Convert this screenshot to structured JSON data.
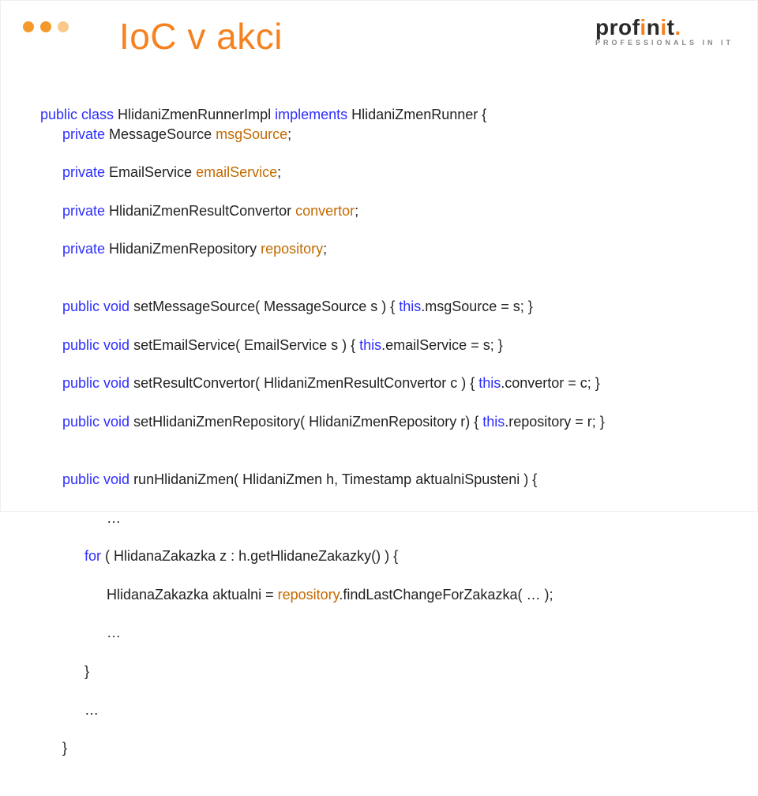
{
  "logo": {
    "brand_black": "prof",
    "brand_orange_i": "i",
    "brand_black2": "n",
    "brand_orange_i2": "i",
    "brand_black3": "t",
    "dot": ".",
    "tagline": "PROFESSIONALS IN IT"
  },
  "title": "IoC v akci",
  "code": {
    "l1_kw": "public class",
    "l1_rest": " HlidaniZmenRunnerImpl ",
    "l1_kw2": "implements",
    "l1_rest2": " HlidaniZmenRunner {",
    "l2_kw": "private",
    "l2_ty": " MessageSource ",
    "l2_fld": "msgSource",
    "l2_end": ";",
    "l3_kw": "private",
    "l3_ty": " EmailService ",
    "l3_fld": "emailService",
    "l3_end": ";",
    "l4_kw": "private",
    "l4_ty": " HlidaniZmenResultConvertor ",
    "l4_fld": "convertor",
    "l4_end": ";",
    "l5_kw": "private",
    "l5_ty": " HlidaniZmenRepository ",
    "l5_fld": "repository",
    "l5_end": ";",
    "l7_kw": "public void",
    "l7_rest": " setMessageSource( MessageSource s ) { ",
    "l7_kw2": "this",
    "l7_rest2": ".msgSource = s; }",
    "l8_kw": "public void",
    "l8_rest": " setEmailService( EmailService s ) { ",
    "l8_kw2": "this",
    "l8_rest2": ".emailService = s; }",
    "l9_kw": "public void",
    "l9_rest": " setResultConvertor( HlidaniZmenResultConvertor c ) { ",
    "l9_kw2": "this",
    "l9_rest2": ".convertor = c; }",
    "l10_kw": "public void",
    "l10_rest": " setHlidaniZmenRepository( HlidaniZmenRepository r) { ",
    "l10_kw2": "this",
    "l10_rest2": ".repository = r; }",
    "l12_kw": "public void",
    "l12_rest": " runHlidaniZmen( HlidaniZmen h, Timestamp aktualniSpusteni ) {",
    "l13": "…",
    "l14_kw": "for",
    "l14_rest": " ( HlidanaZakazka z : h.getHlidaneZakazky() ) {",
    "l15_a": "HlidanaZakazka aktualni = ",
    "l15_hl": "repository",
    "l15_b": ".findLastChangeForZakazka( … );",
    "l16": "…",
    "l17": "}",
    "l18": "…",
    "l19": "}"
  }
}
